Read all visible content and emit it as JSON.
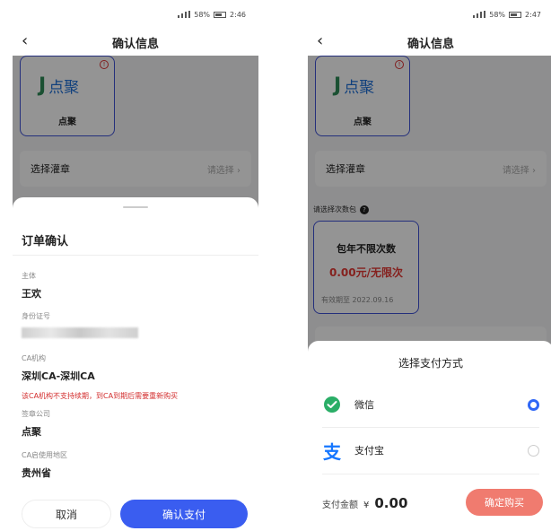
{
  "left_screen": {
    "status": {
      "text": "58%",
      "time": "2:46"
    },
    "nav": {
      "back_icon": "chevron-left-icon",
      "title": "确认信息"
    },
    "seal_card": {
      "brand": "点聚",
      "label": "点聚"
    },
    "seal_select": {
      "label": "选择灌章",
      "placeholder": "请选择"
    },
    "sheet": {
      "title": "订单确认",
      "fields": [
        {
          "label": "主体",
          "value": "王欢"
        },
        {
          "label": "身份证号",
          "value": ""
        },
        {
          "label": "CA机构",
          "value": "深圳CA-深圳CA"
        },
        {
          "label": "签章公司",
          "value": "点聚"
        },
        {
          "label": "CA启使用地区",
          "value": "贵州省"
        }
      ],
      "warning": "该CA机构不支持续期，到CA到期后需要重新购买",
      "cancel_label": "取消",
      "confirm_label": "确认支付"
    }
  },
  "right_screen": {
    "status": {
      "text": "58%",
      "time": "2:47"
    },
    "nav": {
      "back_icon": "chevron-left-icon",
      "title": "确认信息"
    },
    "seal_card": {
      "brand": "点聚",
      "label": "点聚"
    },
    "seal_select": {
      "label": "选择灌章",
      "placeholder": "请选择"
    },
    "package_section_label": "请选择次数包",
    "package": {
      "name": "包年不限次数",
      "price": "0.00元/无限次",
      "expiry": "有效期至 2022.09.16"
    },
    "pay_sheet": {
      "title": "选择支付方式",
      "options": [
        {
          "label": "微信",
          "icon": "wechat-icon",
          "selected": true
        },
        {
          "label": "支付宝",
          "icon": "alipay-icon",
          "selected": false
        }
      ],
      "amount_label": "支付金额",
      "currency": "¥",
      "amount": "0.00",
      "buy_label": "确定购买"
    }
  },
  "colors": {
    "primary": "#3a5df0",
    "danger": "#d32f2f",
    "buy": "#f07b6f",
    "wechat": "#2aae67",
    "alipay": "#1677ff"
  }
}
